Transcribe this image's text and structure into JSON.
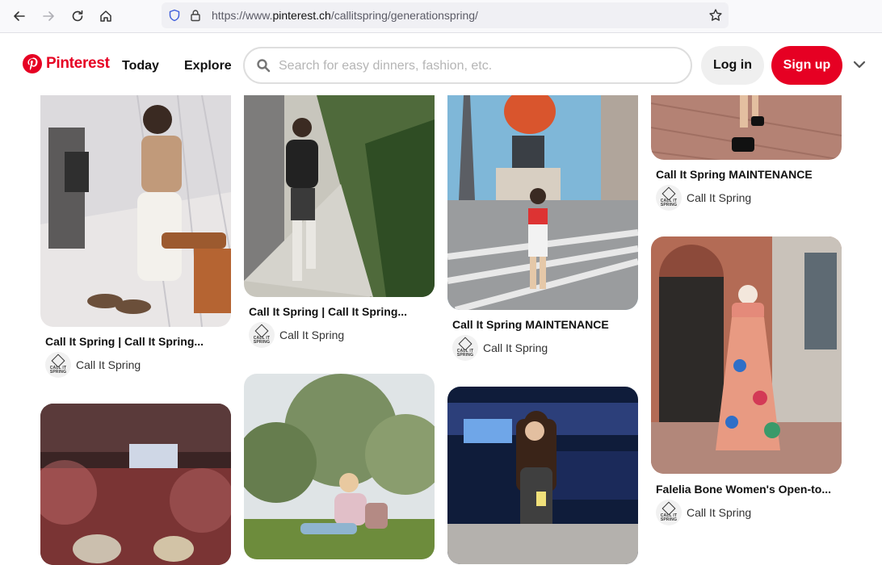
{
  "browser": {
    "url_prefix": "https://www.",
    "url_host": "pinterest.ch",
    "url_path": "/callitspring/generationspring/"
  },
  "header": {
    "logo_text": "Pinterest",
    "nav": {
      "today": "Today",
      "explore": "Explore"
    },
    "search_placeholder": "Search for easy dinners, fashion, etc.",
    "login_label": "Log in",
    "signup_label": "Sign up"
  },
  "colors": {
    "brand": "#e60023",
    "search_border": "#dedede"
  },
  "avatar_text": {
    "line1": "CALL IT",
    "line2": "SPRING"
  },
  "pins": [
    {
      "title": "Call It Spring | Call It Spring...",
      "author": "Call It Spring"
    },
    {
      "title": "Call It Spring | Call It Spring...",
      "author": "Call It Spring"
    },
    {
      "title": "Call It Spring MAINTENANCE",
      "author": "Call It Spring"
    },
    {
      "title": "Call It Spring MAINTENANCE",
      "author": "Call It Spring"
    },
    {
      "title": "Falelia Bone Women's Open-to...",
      "author": "Call It Spring"
    },
    {
      "title": "",
      "author": ""
    },
    {
      "title": "",
      "author": ""
    },
    {
      "title": "",
      "author": ""
    }
  ]
}
